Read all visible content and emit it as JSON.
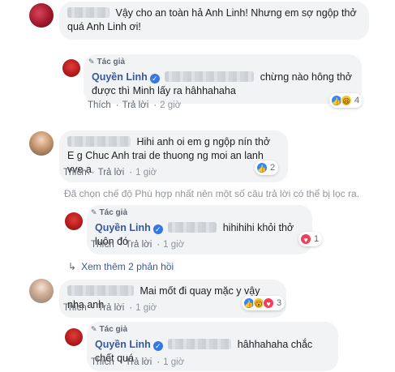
{
  "comments": [
    {
      "text": "Vậy cho an toàn hả Anh Linh! Nhưng em sợ ngộp thở quá Anh Linh ơi!"
    },
    {
      "author_tag": "Tác giả",
      "name": "Quyền Linh",
      "text": "chừng nào hông thở được thì Minh lấy ra hâhhahaha",
      "actions": {
        "like": "Thích",
        "reply": "Trả lời",
        "time": "2 giờ"
      },
      "reaction_count": "4"
    },
    {
      "text_line1": "Hihi anh oi em g ngộp nín thở",
      "text_line2": "E g Chuc Anh trai de thuong ng moi an lanh vve ạ",
      "actions": {
        "like": "Thích",
        "reply": "Trả lời",
        "time": "1 giờ"
      },
      "reaction_count": "2"
    },
    {
      "author_tag": "Tác giả",
      "name": "Quyền Linh",
      "text": "hihihihi khỏi thở luôn đó",
      "actions": {
        "like": "Thích",
        "reply": "Trả lời",
        "time": "1 giờ"
      },
      "reaction_count": "1"
    },
    {
      "text": "Mai mốt đi quay mặc y vậy nha anh",
      "actions": {
        "like": "Thích",
        "reply": "Trả lời",
        "time": "1 giờ"
      },
      "reaction_count": "3"
    },
    {
      "author_tag": "Tác giả",
      "name": "Quyền Linh",
      "text": "hâhhahaha chắc chết quá",
      "actions": {
        "like": "Thích",
        "reply": "Trả lời",
        "time": "1 giờ"
      }
    }
  ],
  "filter_notice": "Đã chọn chế độ Phù hợp nhất nên một số câu trả lời có thể bị lọc ra.",
  "more_replies": "Xem thêm 2 phản hồi",
  "separator": "·"
}
